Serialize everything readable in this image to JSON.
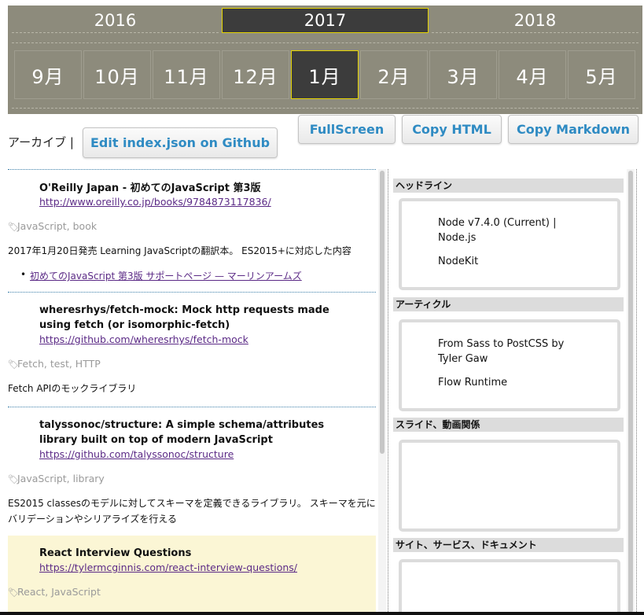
{
  "timeline": {
    "years": [
      "2016",
      "2017",
      "2018"
    ],
    "active_year": "2017",
    "months": [
      "9月",
      "10月",
      "11月",
      "12月",
      "1月",
      "2月",
      "3月",
      "4月",
      "5月"
    ],
    "active_month": "1月"
  },
  "header": {
    "archive_label": "アーカイブ |",
    "edit_button": "Edit index.json on Github",
    "fullscreen_button": "FullScreen",
    "copy_html_button": "Copy HTML",
    "copy_markdown_button": "Copy Markdown"
  },
  "articles": [
    {
      "title": "O'Reilly Japan - 初めてのJavaScript 第3版",
      "url": "http://www.oreilly.co.jp/books/9784873117836/",
      "tags": "JavaScript, book",
      "description": "2017年1月20日発売 Learning JavaScriptの翻訳本。 ES2015+に対応した内容",
      "related_link": "初めてのJavaScript 第3版 サポートページ — マーリンアームズ"
    },
    {
      "title": "wheresrhys/fetch-mock: Mock http requests made using fetch (or isomorphic-fetch)",
      "url": "https://github.com/wheresrhys/fetch-mock",
      "tags": "Fetch, test, HTTP",
      "description": "Fetch APIのモックライブラリ"
    },
    {
      "title": "talyssonoc/structure: A simple schema/attributes library built on top of modern JavaScript",
      "url": "https://github.com/talyssonoc/structure",
      "tags": "JavaScript, library",
      "description": "ES2015 classesのモデルに対してスキーマを定義できるライブラリ。 スキーマを元にバリデーションやシリアライズを行える"
    },
    {
      "title": "React Interview Questions",
      "url": "https://tylermcginnis.com/react-interview-questions/",
      "tags": "React, JavaScript"
    }
  ],
  "sidebar": {
    "sections": [
      {
        "title": "ヘッドライン",
        "items": [
          "Node v7.4.0 (Current) | Node.js",
          "NodeKit"
        ]
      },
      {
        "title": "アーティクル",
        "items": [
          "From Sass to PostCSS by Tyler Gaw",
          "Flow Runtime"
        ]
      },
      {
        "title": "スライド、動画関係",
        "items": []
      },
      {
        "title": "サイト、サービス、ドキュメント",
        "items": []
      }
    ]
  },
  "colors": {
    "timeline_bg": "#8d8b7c",
    "active_bg": "#3c3c3c",
    "active_border": "#e5d400",
    "button_text": "#2f8bc3",
    "link": "#5b2a86",
    "highlight_row": "#fbf6d5"
  },
  "icons": {
    "tag": "tag-icon"
  }
}
